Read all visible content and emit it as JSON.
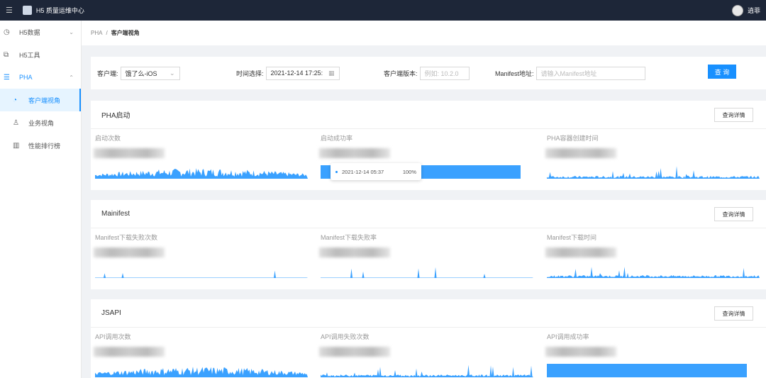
{
  "header": {
    "title": "H5 质量运维中心",
    "user": "逍菲"
  },
  "sidebar": {
    "items": [
      {
        "label": "H5数据",
        "icon": "pie-icon"
      },
      {
        "label": "H5工具",
        "icon": "tool-icon"
      },
      {
        "label": "PHA",
        "icon": "list-icon"
      },
      {
        "label": "客户端视角",
        "icon": "pie-icon"
      },
      {
        "label": "业务视角",
        "icon": "user-icon"
      },
      {
        "label": "性能排行榜",
        "icon": "bar-chart-icon"
      }
    ]
  },
  "breadcrumb": {
    "root": "PHA",
    "sep": "/",
    "current": "客户端视角"
  },
  "filters": {
    "client_label": "客户端:",
    "client_value": "饿了么-iOS",
    "time_label": "时间选择:",
    "time_value": "2021-12-14 17:25:",
    "version_label": "客户端版本:",
    "version_placeholder": "例如: 10.2.0",
    "manifest_label": "Manifest地址:",
    "manifest_placeholder": "请输入Manifest地址",
    "query": "查 询"
  },
  "detail_label": "查询详情",
  "cards": [
    {
      "title": "PHA启动",
      "metrics": [
        "启动次数",
        "启动成功率",
        "PHA容器创建时间"
      ]
    },
    {
      "title": "Mainifest",
      "metrics": [
        "Manifest下载失败次数",
        "Manifest下载失败率",
        "Manifest下载时间"
      ]
    },
    {
      "title": "JSAPI",
      "metrics": [
        "API调用次数",
        "API调用失败次数",
        "API调用成功率"
      ]
    }
  ],
  "tooltip": {
    "time": "2021-12-14 05:37",
    "value": "100%"
  },
  "colors": {
    "accent": "#1890ff",
    "topbar": "#1d2638"
  }
}
